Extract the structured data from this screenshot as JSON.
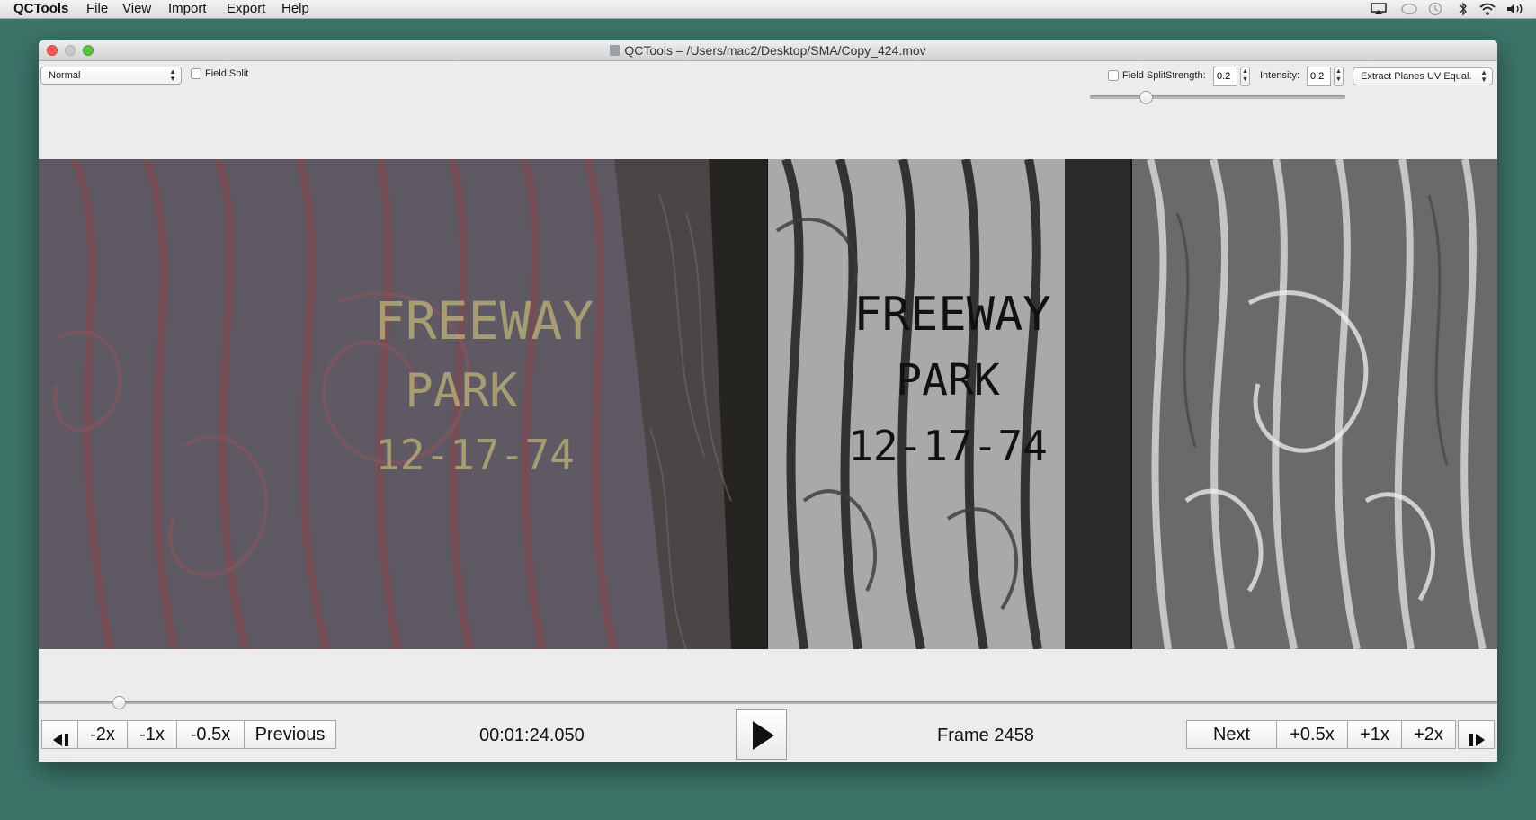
{
  "menubar": {
    "app_name": "QCTools",
    "menus": [
      "File",
      "View",
      "Import",
      "Export",
      "Help"
    ]
  },
  "window": {
    "title": "QCTools – /Users/mac2/Desktop/SMA/Copy_424.mov"
  },
  "left_controls": {
    "view_mode": "Normal",
    "field_split_label": "Field Split"
  },
  "filter_controls": {
    "field_split_label": "Field Split",
    "strength_label": "Strength:",
    "strength_value": "0.2",
    "intensity_label": "Intensity:",
    "intensity_value": "0.2",
    "filter_name": "Extract Planes UV Equal.",
    "slider_level": 0.22
  },
  "video": {
    "left_text_lines": [
      "FREEWAY",
      "PARK",
      "12-17-74"
    ],
    "middle_text_lines": [
      "FREEWAY",
      "PARK",
      "12-17-74"
    ]
  },
  "playback": {
    "timeline_position": 0.055,
    "prev_labels": [
      "-2x",
      "-1x",
      "-0.5x",
      "Previous"
    ],
    "timecode": "00:01:24.050",
    "frame_label": "Frame 2458",
    "next_labels": [
      "Next",
      "+0.5x",
      "+1x",
      "+2x"
    ]
  },
  "icons": {
    "play": "play-icon",
    "go_start": "go-to-start-icon",
    "go_end": "go-to-end-icon"
  }
}
